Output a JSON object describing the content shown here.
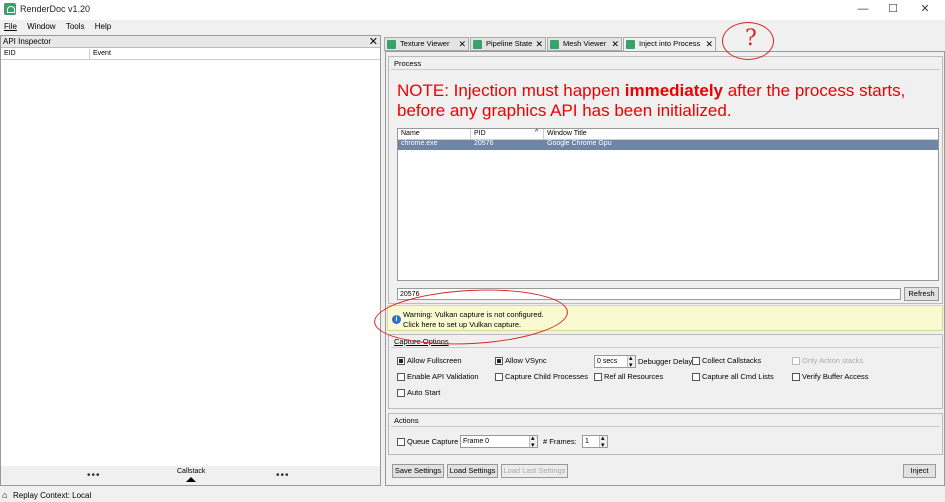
{
  "window": {
    "title": "RenderDoc v1.20",
    "controls": [
      "—",
      "☐",
      "✕"
    ]
  },
  "menu": [
    "File",
    "Window",
    "Tools",
    "Help"
  ],
  "api_inspector": {
    "title": "API Inspector",
    "close": "✕",
    "columns": [
      "EID",
      "Event"
    ],
    "footer_left": "•••",
    "footer_center": "Callstack",
    "footer_right": "•••"
  },
  "status": {
    "text": "Replay Context: Local",
    "icon": "home-icon"
  },
  "tabs": [
    {
      "label": "Texture Viewer",
      "close": "✕",
      "icon": "texture-icon"
    },
    {
      "label": "Pipeline State",
      "close": "✕",
      "icon": "pipeline-icon"
    },
    {
      "label": "Mesh Viewer",
      "close": "✕",
      "icon": "mesh-icon"
    },
    {
      "label": "Inject into Process",
      "close": "✕",
      "icon": "inject-icon"
    }
  ],
  "process": {
    "title": "Process",
    "note_prefix": "NOTE: Injection must happen ",
    "note_bold": "immediately",
    "note_suffix": " after the process starts,",
    "note_line2": "before any graphics API has been initialized.",
    "columns": [
      "Name",
      "PID",
      "Window Title"
    ],
    "rows": [
      {
        "name": "chrome.exe",
        "pid": "20576",
        "window_title": "Google Chrome Gpu"
      }
    ],
    "pid_value": "20576",
    "refresh_label": "Refresh"
  },
  "warning": {
    "line1": "Warning: Vulkan capture is not configured.",
    "line2": "Click here to set up Vulkan capture."
  },
  "capture_options": {
    "title": "Capture Options",
    "allow_fullscreen": "Allow Fullscreen",
    "allow_vsync": "Allow VSync",
    "debugger_delay_value": "0 secs",
    "debugger_delay_label": "Debugger Delay",
    "collect_callstacks": "Collect Callstacks",
    "only_action_stacks": "Only Action stacks",
    "enable_api_validation": "Enable API Validation",
    "capture_child_processes": "Capture Child Processes",
    "ref_all_resources": "Ref all Resources",
    "capture_all_cmd_lists": "Capture all Cmd Lists",
    "verify_buffer_access": "Verify Buffer Access",
    "auto_start": "Auto Start"
  },
  "actions": {
    "title": "Actions",
    "queue_capture": "Queue Capture",
    "frame_value": "Frame 0",
    "frames_label": "# Frames:",
    "frames_value": "1"
  },
  "bottom_buttons": {
    "save": "Save Settings",
    "load": "Load Settings",
    "load_last": "Load Last Settings",
    "inject": "Inject"
  },
  "annotation": {
    "mark": "?"
  }
}
